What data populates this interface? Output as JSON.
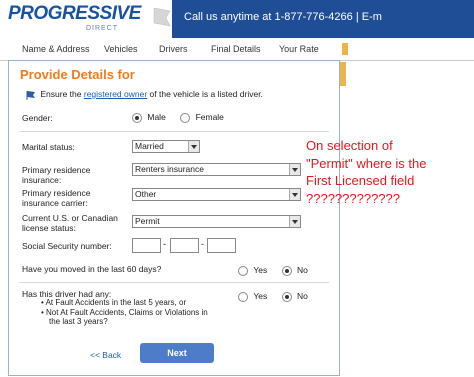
{
  "brand": {
    "name": "PROGRESSIVE",
    "sub": "DIRECT"
  },
  "callbar": {
    "text": "Call us anytime at 1-877-776-4266  |  E-m"
  },
  "steps": [
    {
      "label": "Name & Address"
    },
    {
      "label": "Vehicles"
    },
    {
      "label": "Drivers"
    },
    {
      "label": "Final Details"
    },
    {
      "label": "Your Rate"
    }
  ],
  "form": {
    "title": "Provide Details for",
    "notice_pre": "Ensure the ",
    "notice_link": "registered owner",
    "notice_post": " of the vehicle is a listed driver.",
    "gender": {
      "label": "Gender:",
      "male": "Male",
      "female": "Female",
      "selected": "Male"
    },
    "marital": {
      "label": "Marital status:",
      "value": "Married"
    },
    "residence": {
      "label_1": "Primary residence",
      "label_2": "insurance:",
      "value": "Renters insurance"
    },
    "carrier": {
      "label_1": "Primary residence",
      "label_2": "insurance carrier:",
      "value": "Other"
    },
    "license": {
      "label_1": "Current U.S. or Canadian",
      "label_2": "license status:",
      "value": "Permit"
    },
    "ssn": {
      "label": "Social Security number:",
      "dash": "-"
    },
    "moved": {
      "label": "Have you moved in the last 60 days?",
      "yes": "Yes",
      "no": "No",
      "selected": "No"
    },
    "history": {
      "label": "Has this driver had any:",
      "bullet_1": "At Fault Accidents in the last 5 years, or",
      "bullet_2a": "Not At Fault Accidents, Claims or Violations in",
      "bullet_2b": "the last 3 years?",
      "yes": "Yes",
      "no": "No",
      "selected": "No"
    },
    "back": "<< Back",
    "next": "Next"
  },
  "annotation": {
    "line_1": "On selection of",
    "line_2": "\"Permit\" where is the",
    "line_3": "First Licensed field",
    "line_4": "?????????????"
  },
  "colors": {
    "brand_blue": "#1f4d96",
    "title_orange": "#f07c1f",
    "annotation_red": "#e0191f",
    "next_blue": "#4d7dc9"
  }
}
